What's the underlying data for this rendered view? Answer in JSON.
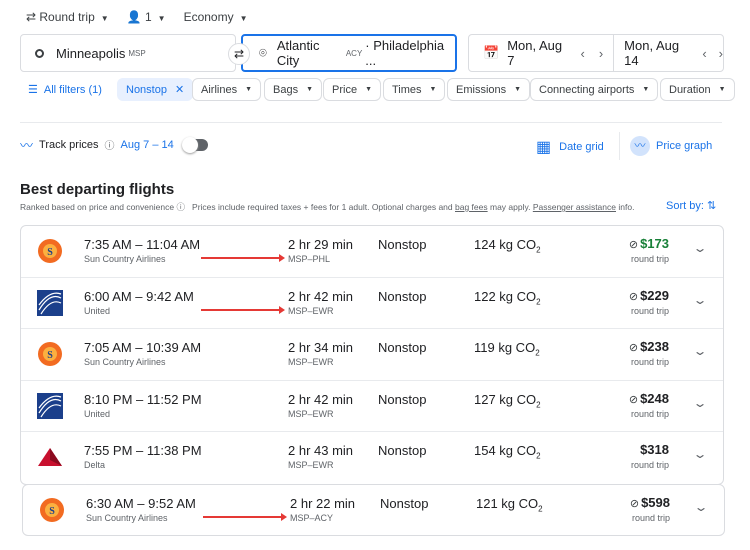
{
  "top": {
    "trip": "Round trip",
    "passengers": "1",
    "cabin": "Economy"
  },
  "search": {
    "origin": "Minneapolis",
    "origin_code": "MSP",
    "destination": "Atlantic City",
    "destination_code": "ACY",
    "destination_more": "· Philadelphia ...",
    "depart": "Mon, Aug 7",
    "return": "Mon, Aug 14"
  },
  "filters": {
    "all": "All filters (1)",
    "items": [
      "Nonstop",
      "Airlines",
      "Bags",
      "Price",
      "Times",
      "Emissions",
      "Connecting airports",
      "Duration"
    ]
  },
  "track": {
    "label": "Track prices",
    "dates": "Aug 7 – 14",
    "date_grid": "Date grid",
    "price_graph": "Price graph"
  },
  "section": {
    "title": "Best departing flights",
    "ranked": "Ranked based on price and convenience",
    "note_1": "Prices include required taxes + fees for 1 adult. Optional charges and ",
    "bag_fees": "bag fees",
    "note_2": " may apply. ",
    "passenger": "Passenger assistance",
    "note_3": " info.",
    "sort": "Sort by:"
  },
  "colors": {
    "accent": "#1a73e8",
    "price_low": "#188038",
    "annotation": "#e53935"
  },
  "flights": [
    {
      "times": "7:35 AM – 11:04 AM",
      "airline": "Sun Country Airlines",
      "logo": "suncountry",
      "duration": "2 hr 29 min",
      "route": "MSP–PHL",
      "stops": "Nonstop",
      "co2": "124 kg CO",
      "price": "$173",
      "price_note": "round trip",
      "no_bag": true,
      "arrow": true,
      "green": true
    },
    {
      "times": "6:00 AM – 9:42 AM",
      "airline": "United",
      "logo": "united",
      "duration": "2 hr 42 min",
      "route": "MSP–EWR",
      "stops": "Nonstop",
      "co2": "122 kg CO",
      "price": "$229",
      "price_note": "round trip",
      "no_bag": true,
      "arrow": true
    },
    {
      "times": "7:05 AM – 10:39 AM",
      "airline": "Sun Country Airlines",
      "logo": "suncountry",
      "duration": "2 hr 34 min",
      "route": "MSP–EWR",
      "stops": "Nonstop",
      "co2": "119 kg CO",
      "price": "$238",
      "price_note": "round trip",
      "no_bag": true
    },
    {
      "times": "8:10 PM – 11:52 PM",
      "airline": "United",
      "logo": "united",
      "duration": "2 hr 42 min",
      "route": "MSP–EWR",
      "stops": "Nonstop",
      "co2": "127 kg CO",
      "price": "$248",
      "price_note": "round trip",
      "no_bag": true
    },
    {
      "times": "7:55 PM – 11:38 PM",
      "airline": "Delta",
      "logo": "delta",
      "duration": "2 hr 43 min",
      "route": "MSP–EWR",
      "stops": "Nonstop",
      "co2": "154 kg CO",
      "price": "$318",
      "price_note": "round trip",
      "no_bag": false
    },
    {
      "times": "6:30 AM – 9:52 AM",
      "airline": "Sun Country Airlines",
      "logo": "suncountry",
      "duration": "2 hr 22 min",
      "route": "MSP–ACY",
      "stops": "Nonstop",
      "co2": "121 kg CO",
      "price": "$598",
      "price_note": "round trip",
      "no_bag": true,
      "arrow": true
    }
  ]
}
